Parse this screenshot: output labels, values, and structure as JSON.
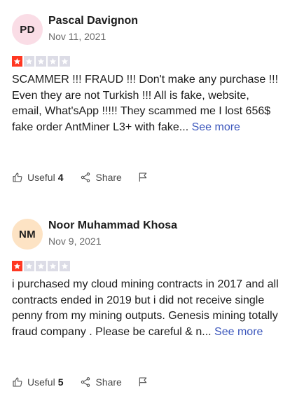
{
  "reviews": [
    {
      "initials": "PD",
      "avatar_color": "#fadde6",
      "name": "Pascal Davignon",
      "date": "Nov 11, 2021",
      "rating": 1,
      "text": "SCAMMER !!! FRAUD !!! Don't make any purchase !!! Even they are not Turkish !!! All is fake, website, email, What'sApp !!!!! They scammed me I lost 656$ fake order AntMiner L3+ with fake...",
      "see_more": "See more",
      "useful_label": "Useful",
      "useful_count": "4",
      "share_label": "Share"
    },
    {
      "initials": "NM",
      "avatar_color": "#fde3c4",
      "name": "Noor Muhammad Khosa",
      "date": "Nov 9, 2021",
      "rating": 1,
      "text": "i purchased my cloud mining contracts in 2017 and all contracts ended in 2019 but i did not receive single penny from my mining outputs. Genesis mining totally fraud company . Please be careful & n...",
      "see_more": "See more",
      "useful_label": "Useful",
      "useful_count": "5",
      "share_label": "Share"
    }
  ],
  "colors": {
    "star_active": "#ff3722",
    "star_inactive": "#dcdce6",
    "link": "#3c57bc"
  },
  "icons": {
    "useful": "thumbs-up-icon",
    "share": "share-icon",
    "flag": "flag-icon",
    "star": "star-icon"
  }
}
